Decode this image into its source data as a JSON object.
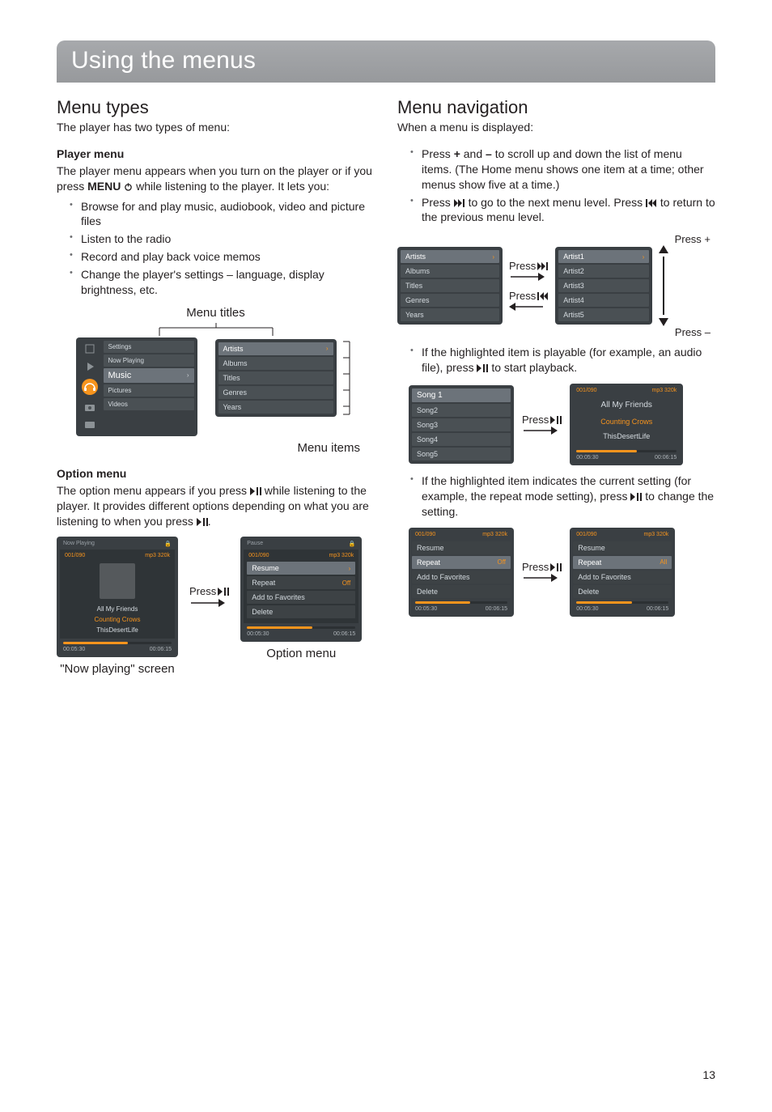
{
  "pageTitle": "Using the menus",
  "pageNumber": "13",
  "left": {
    "h2": "Menu types",
    "sub": "The player has two types of menu:",
    "playerMenu": {
      "heading": "Player menu",
      "p1a": "The player menu appears when you turn on the player or if you press ",
      "p1bold": "MENU",
      "p1b": " while listening to the player. It lets you:",
      "items": [
        "Browse for and play music, audiobook, video and picture files",
        "Listen to the radio",
        "Record and play back voice memos",
        "Change the player's settings – language, display brightness, etc."
      ]
    },
    "fig1": {
      "titlesLabel": "Menu titles",
      "itemsLabel": "Menu items",
      "homeMenu": [
        "Settings",
        "Now Playing",
        "Music",
        "Pictures",
        "Videos"
      ],
      "musicMenu": [
        "Artists",
        "Albums",
        "Titles",
        "Genres",
        "Years"
      ]
    },
    "optionMenu": {
      "heading": "Option menu",
      "p1a": "The option menu appears if you press ",
      "p1b": " while listening to the player. It provides different options depending on what you are listening to when you press ",
      "p1c": "."
    },
    "fig2": {
      "npHeader": "Now Playing",
      "npTrack": "001/090",
      "npFmt": "mp3 320k",
      "npLines": [
        "All My Friends",
        "Counting Crows",
        "ThisDesertLife"
      ],
      "timeL": "00:05:30",
      "timeR": "00:06:15",
      "npLabel": "\"Now playing\" screen",
      "pause": "Pause",
      "opt": [
        "Resume",
        "Repeat",
        "Add to Favorites",
        "Delete"
      ],
      "offVal": "Off",
      "optLabel": "Option menu",
      "pressPlay": "Press"
    }
  },
  "right": {
    "h2": "Menu navigation",
    "sub": "When a menu is displayed:",
    "bullets": {
      "b1a": "Press ",
      "b1plus": "+",
      "b1b": " and ",
      "b1minus": "–",
      "b1c": " to scroll up and down the list of menu items. (The Home menu shows one item at a time; other menus show five at a time.)",
      "b2a": "Press ",
      "b2b": " to go to the next menu level. Press ",
      "b2c": " to return to the previous menu level."
    },
    "fig3": {
      "pressNext": "Press",
      "pressPrev": "Press",
      "pressPlus": "Press +",
      "pressMinus": "Press –",
      "leftMenu": [
        "Artists",
        "Albums",
        "Titles",
        "Genres",
        "Years"
      ],
      "rightMenu": [
        "Artist1",
        "Artist2",
        "Artist3",
        "Artist4",
        "Artist5"
      ]
    },
    "bullet3a": "If the highlighted item is playable (for example, an audio file), press ",
    "bullet3b": " to start playback.",
    "fig4": {
      "pressPlay": "Press",
      "songs": [
        "Song 1",
        "Song2",
        "Song3",
        "Song4",
        "Song5"
      ],
      "track": "001/090",
      "fmt": "mp3 320k",
      "l1": "All My Friends",
      "l2": "Counting Crows",
      "l3": "ThisDesertLife",
      "timeL": "00:05:30",
      "timeR": "00:06:15"
    },
    "bullet4a": "If the highlighted item indicates the current setting (for example, the repeat mode setting), press ",
    "bullet4b": " to change the setting.",
    "fig5": {
      "pressPlay": "Press",
      "track": "001/090",
      "fmt": "mp3 320k",
      "opt": [
        "Resume",
        "Repeat",
        "Add to Favorites",
        "Delete"
      ],
      "offVal": "Off",
      "allVal": "All",
      "timeL": "00:05:30",
      "timeR": "00:06:15"
    }
  }
}
